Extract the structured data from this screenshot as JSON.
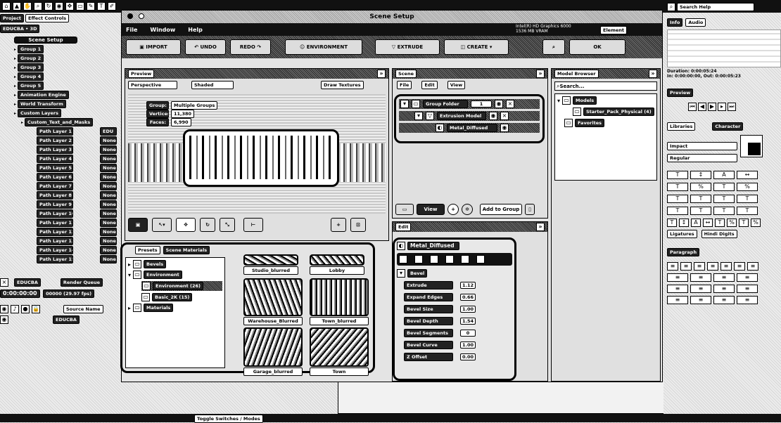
{
  "left": {
    "tab_project": "Project",
    "tab_effect_controls": "Effect Controls",
    "layer_crumb": "EDUCBA • 3D",
    "scene_setup_btn": "Scene Setup",
    "tree": [
      "Group 1",
      "Group 2",
      "Group 3",
      "Group 4",
      "Group 5",
      "Animation Engine",
      "World Transform",
      "Custom Layers",
      "Custom_Text_and_Masks"
    ],
    "path_layers": [
      "Path Layer 1",
      "Path Layer 2",
      "Path Layer 3",
      "Path Layer 4",
      "Path Layer 5",
      "Path Layer 6",
      "Path Layer 7",
      "Path Layer 8",
      "Path Layer 9",
      "Path Layer 10",
      "Path Layer 11",
      "Path Layer 12",
      "Path Layer 13",
      "Path Layer 14",
      "Path Layer 15"
    ],
    "path_modes": [
      "EDU",
      "None",
      "None",
      "None",
      "None",
      "None",
      "None",
      "None",
      "None",
      "None",
      "None",
      "None",
      "None",
      "None",
      "None"
    ],
    "timeline_tab": "EDUCBA",
    "render_tab": "Render Queue",
    "timecode": "0:00:00:00",
    "fps": "00000 (29.97 fps)",
    "source_name": "Source Name",
    "timeline_item": "EDUCBA",
    "toggle_label": "Toggle Switches / Modes"
  },
  "window": {
    "title": "Scene Setup",
    "menu": [
      "File",
      "Window",
      "Help"
    ],
    "gpu_line1": "Intel(R) HD Graphics 6000",
    "gpu_line2": "1536 MB VRAM",
    "element_label": "Element",
    "toolbar": {
      "import": "IMPORT",
      "undo": "UNDO",
      "redo": "REDO",
      "environment": "ENVIRONMENT",
      "extrude": "EXTRUDE",
      "create": "CREATE",
      "ok": "OK"
    },
    "preview": {
      "title": "Preview",
      "view_select": "Perspective",
      "shade_select": "Shaded",
      "draw_textures": "Draw Textures",
      "info": [
        [
          "Group:",
          "Multiple Groups"
        ],
        [
          "Vertices:",
          "11,380"
        ],
        [
          "Faces:",
          "6,990"
        ]
      ]
    },
    "scene": {
      "title": "Scene",
      "menu": [
        "File",
        "Edit",
        "View"
      ],
      "group_folder": "Group Folder",
      "group_num": "1",
      "extrusion_model": "Extrusion Model",
      "material": "Metal_Diffused",
      "view_btn": "View",
      "add_to_group": "Add to Group"
    },
    "model_browser": {
      "title": "Model Browser",
      "search_placeholder": "Search...",
      "models": "Models",
      "starter_pack": "Starter_Pack_Physical (4)",
      "favorites": "Favorites"
    },
    "edit": {
      "title": "Edit",
      "material_name": "Metal_Diffused",
      "section": "Bevel",
      "params": [
        [
          "Extrude",
          "1.12"
        ],
        [
          "Expand Edges",
          "0.66"
        ],
        [
          "Bevel Size",
          "1.00"
        ],
        [
          "Bevel Depth",
          "1.54"
        ],
        [
          "Bevel Segments",
          "0"
        ],
        [
          "Bevel Curve",
          "1.00"
        ],
        [
          "Z Offset",
          "0.00"
        ]
      ]
    },
    "materials": {
      "tab_presets": "Presets",
      "tab_scene": "Scene Materials",
      "tree": [
        "Bevels",
        "Environment",
        "Environment (26)",
        "Basic_2K (15)",
        "Materials"
      ],
      "thumbs": [
        "Studio_blurred",
        "Lobby",
        "Warehouse_Blurred",
        "Town_blurred",
        "Garage_blurred",
        "Town"
      ]
    }
  },
  "right": {
    "search_help_placeholder": "Search Help",
    "tab_info": "Info",
    "tab_audio": "Audio",
    "timing1": "Duration: 0:00:05:24",
    "timing2": "In: 0:00:00:00, Out: 0:00:05:23",
    "preview_tab": "Preview",
    "libraries_tab": "Libraries",
    "character_tab": "Character",
    "font_name": "Impact",
    "font_style": "Regular",
    "ligatures": "Ligatures",
    "hindi_digits": "Hindi Digits",
    "paragraph_tab": "Paragraph"
  },
  "colors": {
    "accent_black": "#111111",
    "white": "#ffffff",
    "dither_light": "#ececec"
  }
}
